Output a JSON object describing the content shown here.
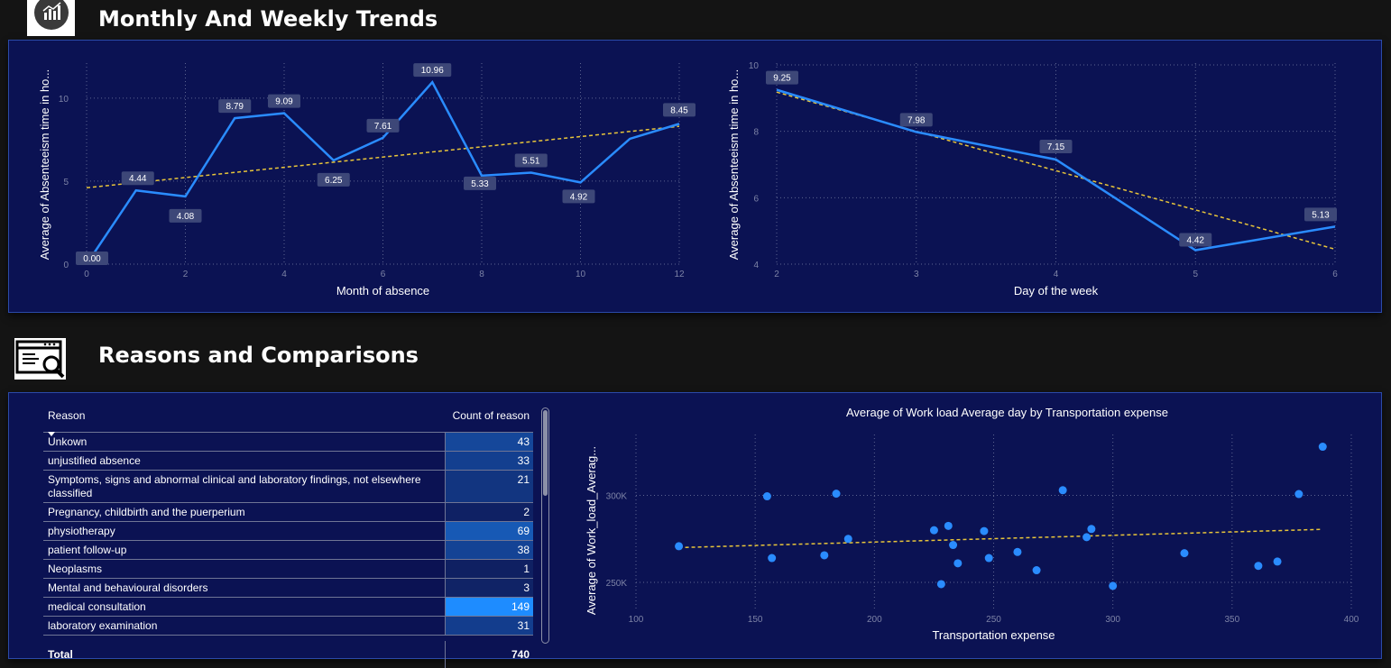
{
  "sections": {
    "trends_title": "Monthly And Weekly Trends",
    "reasons_title": "Reasons and Comparisons"
  },
  "colors": {
    "panel_bg": "#0b1253",
    "line": "#2a8cff",
    "trend": "#e8c53a",
    "label_box": "#3d4778",
    "highlight_cell": "#1e8cff"
  },
  "icons": {
    "trends_icon": "bar-chart-icon",
    "reasons_icon": "web-search-icon"
  },
  "chart_data": [
    {
      "type": "line",
      "xlabel": "Month of absence",
      "ylabel": "Average of Absenteeism time in ho...",
      "x": [
        0,
        1,
        2,
        3,
        4,
        5,
        6,
        7,
        8,
        9,
        10,
        11,
        12
      ],
      "series": [
        {
          "values": [
            0.0,
            4.44,
            4.08,
            8.79,
            9.09,
            6.25,
            7.61,
            10.96,
            5.33,
            5.51,
            4.92,
            7.55,
            8.45
          ]
        }
      ],
      "data_labels": [
        "0.00",
        "4.44",
        "4.08",
        "8.79",
        "9.09",
        "6.25",
        "7.61",
        "10.96",
        "5.33",
        "5.51",
        "4.92",
        null,
        "8.45"
      ],
      "trendline": {
        "x": [
          0,
          12
        ],
        "y": [
          4.6,
          8.3
        ]
      },
      "xlim": [
        0,
        12
      ],
      "ylim": [
        0,
        12
      ],
      "xticks": [
        "0",
        "2",
        "4",
        "6",
        "8",
        "10",
        "12"
      ],
      "yticks": [
        "0",
        "5",
        "10"
      ],
      "grid": true
    },
    {
      "type": "line",
      "xlabel": "Day of the week",
      "ylabel": "Average of Absenteeism time in ho...",
      "x": [
        2,
        3,
        4,
        5,
        6
      ],
      "series": [
        {
          "values": [
            9.25,
            7.98,
            7.15,
            4.42,
            5.13
          ]
        }
      ],
      "data_labels": [
        "9.25",
        "7.98",
        "7.15",
        "4.42",
        "5.13"
      ],
      "trendline": {
        "x": [
          2,
          6
        ],
        "y": [
          9.18,
          4.45
        ]
      },
      "xlim": [
        2,
        6
      ],
      "ylim": [
        4,
        10
      ],
      "xticks": [
        "2",
        "3",
        "4",
        "5",
        "6"
      ],
      "yticks": [
        "4",
        "6",
        "8",
        "10"
      ],
      "grid": true
    },
    {
      "type": "table",
      "columns": [
        "Reason",
        "Count of reason"
      ],
      "rows": [
        [
          "Unkown",
          "43"
        ],
        [
          "unjustified absence",
          "33"
        ],
        [
          "Symptoms, signs and abnormal clinical and laboratory findings, not elsewhere classified",
          "21"
        ],
        [
          "Pregnancy, childbirth and the puerperium",
          "2"
        ],
        [
          "physiotherapy",
          "69"
        ],
        [
          "patient follow-up",
          "38"
        ],
        [
          "Neoplasms",
          "1"
        ],
        [
          "Mental and behavioural disorders",
          "3"
        ],
        [
          "medical consultation",
          "149"
        ],
        [
          "laboratory examination",
          "31"
        ]
      ],
      "total": [
        "Total",
        "740"
      ]
    },
    {
      "type": "scatter",
      "title": "Average of Work load Average day by Transportation expense",
      "xlabel": "Transportation expense",
      "ylabel": "Average of Work_load_Averag...",
      "xlim": [
        100,
        400
      ],
      "ylim": [
        235000,
        335000
      ],
      "xticks": [
        "100",
        "150",
        "200",
        "250",
        "300",
        "350",
        "400"
      ],
      "yticks": [
        "250K",
        "300K"
      ],
      "points": [
        [
          118,
          270800
        ],
        [
          155,
          299500
        ],
        [
          157,
          264000
        ],
        [
          179,
          265600
        ],
        [
          184,
          301000
        ],
        [
          189,
          275000
        ],
        [
          225,
          280000
        ],
        [
          228,
          249000
        ],
        [
          231,
          282500
        ],
        [
          233,
          271500
        ],
        [
          235,
          261000
        ],
        [
          246,
          279500
        ],
        [
          248,
          264000
        ],
        [
          260,
          267500
        ],
        [
          268,
          257000
        ],
        [
          279,
          303000
        ],
        [
          289,
          276000
        ],
        [
          291,
          280700
        ],
        [
          300,
          248000
        ],
        [
          330,
          266800
        ],
        [
          361,
          259500
        ],
        [
          369,
          262000
        ],
        [
          378,
          300800
        ],
        [
          388,
          328000
        ]
      ],
      "trendline": {
        "x": [
          118,
          388
        ],
        "y": [
          270000,
          280500
        ]
      },
      "grid": true
    }
  ]
}
